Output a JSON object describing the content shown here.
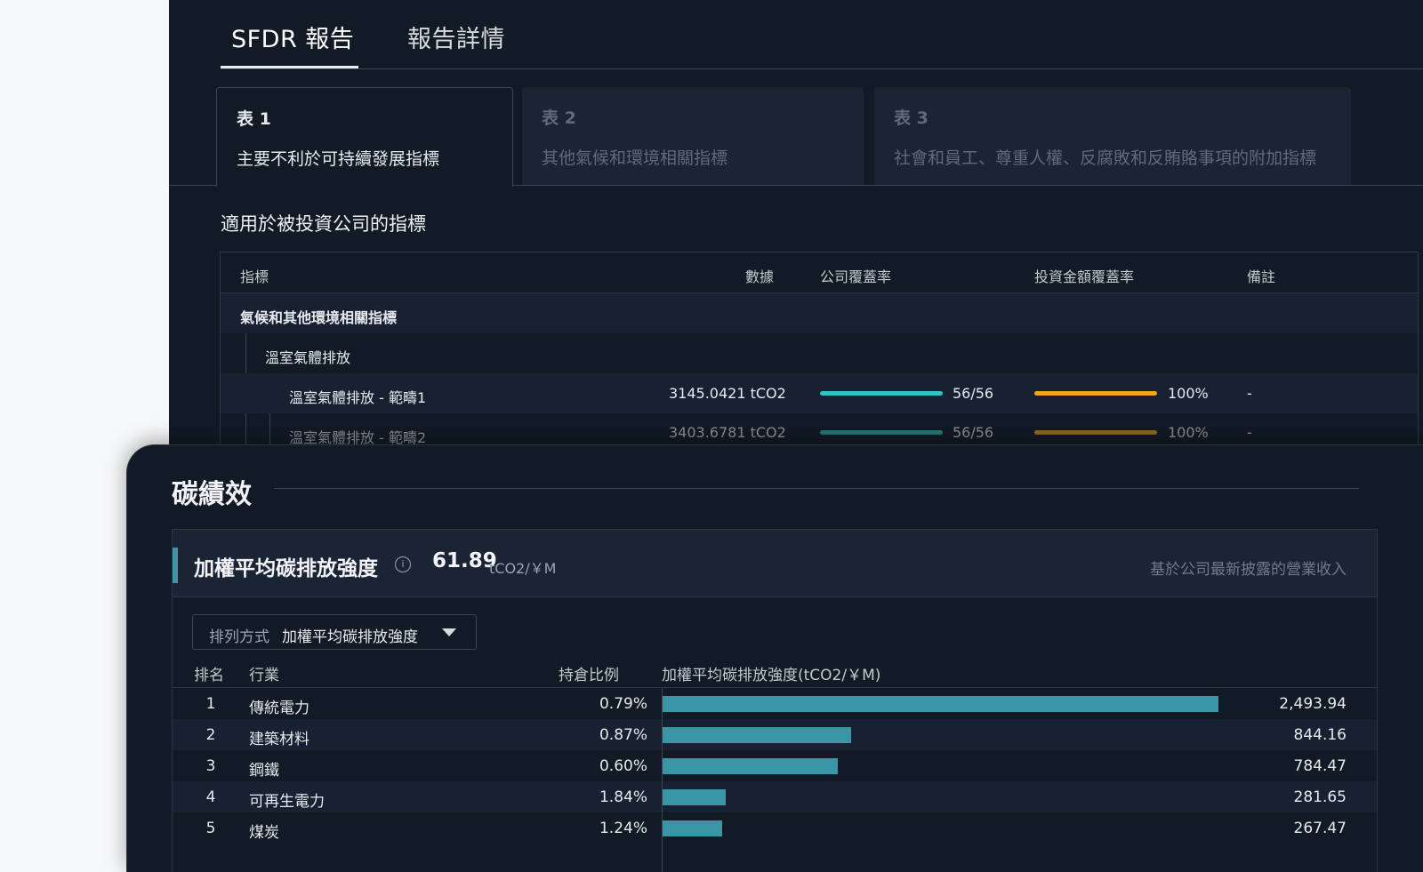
{
  "report": {
    "tabs": [
      {
        "label": "SFDR 報告",
        "active": true
      },
      {
        "label": "報告詳情",
        "active": false
      }
    ],
    "sheets": [
      {
        "num": "表 1",
        "desc": "主要不利於可持續發展指標",
        "active": true
      },
      {
        "num": "表 2",
        "desc": "其他氣候和環境相關指標",
        "active": false
      },
      {
        "num": "表 3",
        "desc": "社會和員工、尊重人權、反腐敗和反賄賂事項的附加指標",
        "active": false
      }
    ],
    "section_title": "適用於被投資公司的指標",
    "columns": [
      "指標",
      "數據",
      "公司覆蓋率",
      "投資金額覆蓋率",
      "備註"
    ],
    "group": "氣候和其他環境相關指標",
    "subgroup": "溫室氣體排放",
    "rows": [
      {
        "name": "溫室氣體排放 - 範疇1",
        "value": "3145.0421 tCO2",
        "company_coverage": "56/56",
        "company_coverage_ratio": 1.0,
        "amount_coverage": "100%",
        "amount_coverage_ratio": 1.0,
        "note": "-"
      },
      {
        "name": "溫室氣體排放 - 範疇2",
        "value": "3403.6781 tCO2",
        "company_coverage": "56/56",
        "company_coverage_ratio": 1.0,
        "amount_coverage": "100%",
        "amount_coverage_ratio": 1.0,
        "note": "-"
      }
    ],
    "colors": {
      "company_bar": "#2ec4c4",
      "amount_bar": "#f2a516"
    }
  },
  "carbon": {
    "title": "碳績效",
    "metric_name": "加權平均碳排放強度",
    "info_icon": "info-icon",
    "metric_value": "61.89",
    "metric_unit": "tCO2/￥M",
    "note": "基於公司最新披露的營業收入",
    "sort": {
      "label": "排列方式",
      "value": "加權平均碳排放強度",
      "icon": "chevron-down-icon"
    },
    "columns": {
      "rank": "排名",
      "industry": "行業",
      "holding": "持倉比例",
      "intensity": "加權平均碳排放強度(tCO2/￥M)"
    },
    "accent_color": "#3a95a6",
    "max_value": 2493.94,
    "rows": [
      {
        "rank": "1",
        "industry": "傳統電力",
        "holding": "0.79%",
        "value": 2493.94,
        "label": "2,493.94"
      },
      {
        "rank": "2",
        "industry": "建築材料",
        "holding": "0.87%",
        "value": 844.16,
        "label": "844.16"
      },
      {
        "rank": "3",
        "industry": "鋼鐵",
        "holding": "0.60%",
        "value": 784.47,
        "label": "784.47"
      },
      {
        "rank": "4",
        "industry": "可再生電力",
        "holding": "1.84%",
        "value": 281.65,
        "label": "281.65"
      },
      {
        "rank": "5",
        "industry": "煤炭",
        "holding": "1.24%",
        "value": 267.47,
        "label": "267.47"
      }
    ]
  }
}
